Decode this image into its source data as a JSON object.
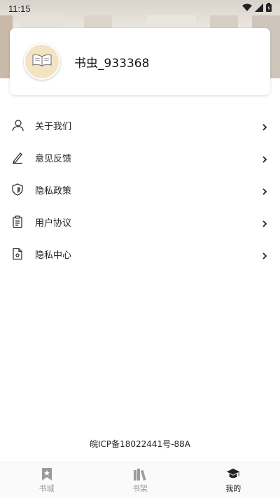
{
  "status_bar": {
    "time": "11:15"
  },
  "profile": {
    "username": "书虫_933368",
    "avatar_icon": "open-book-icon"
  },
  "menu": {
    "items": [
      {
        "label": "关于我们",
        "icon": "person-icon"
      },
      {
        "label": "意见反馈",
        "icon": "pen-icon"
      },
      {
        "label": "隐私政策",
        "icon": "shield-icon"
      },
      {
        "label": "用户协议",
        "icon": "clipboard-icon"
      },
      {
        "label": "隐私中心",
        "icon": "document-icon"
      }
    ]
  },
  "footer": {
    "icp": "皖ICP备18022441号-88A"
  },
  "tabbar": {
    "tabs": [
      {
        "label": "书城",
        "icon": "bookmark-icon",
        "active": false
      },
      {
        "label": "书架",
        "icon": "books-icon",
        "active": false
      },
      {
        "label": "我的",
        "icon": "graduation-cap-icon",
        "active": true
      }
    ]
  },
  "colors": {
    "active_tab": "#222222",
    "inactive_tab": "#9a9a9a",
    "avatar_bg": "#f2e3c3"
  }
}
